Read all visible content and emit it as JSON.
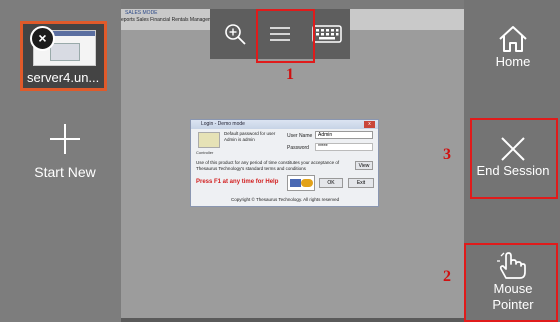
{
  "left": {
    "session_tile": {
      "label": "server4.un...",
      "close_glyph": "×"
    },
    "start_new": {
      "label": "Start New"
    }
  },
  "remote": {
    "mode_text": "SALES MODE",
    "menu_text": "eports  Sales Financial  Rentals Management  Help  Exit"
  },
  "dialog": {
    "title": "Login - Demo mode",
    "close_glyph": "x",
    "info": "Default password for user Admin is admin",
    "logo_label": "Controller",
    "user_label": "User Name",
    "user_value": "Admin",
    "pass_label": "Password",
    "pass_value": "*****",
    "terms": "Use of this product for any period of time constitutes your acceptance of Thesaurus Technology's standard terms and conditions",
    "view_button": "View",
    "help_text": "Press F1 at any time for Help",
    "ok_button": "OK",
    "exit_button": "Exit",
    "copyright": "Copyright © Thesaurus Technology. All rights reserved"
  },
  "right": {
    "home_label": "Home",
    "end_session_label": "End Session",
    "mouse_pointer_label_1": "Mouse",
    "mouse_pointer_label_2": "Pointer"
  },
  "annotations": {
    "num_1": "1",
    "num_2": "2",
    "num_3": "3",
    "color": "#e01b1b"
  },
  "icons": {
    "toolbar": [
      "zoom-in-icon",
      "menu-icon",
      "keyboard-icon"
    ],
    "right": [
      "home-icon",
      "close-x-icon",
      "hand-pointer-icon"
    ],
    "left": [
      "plus-icon"
    ]
  }
}
